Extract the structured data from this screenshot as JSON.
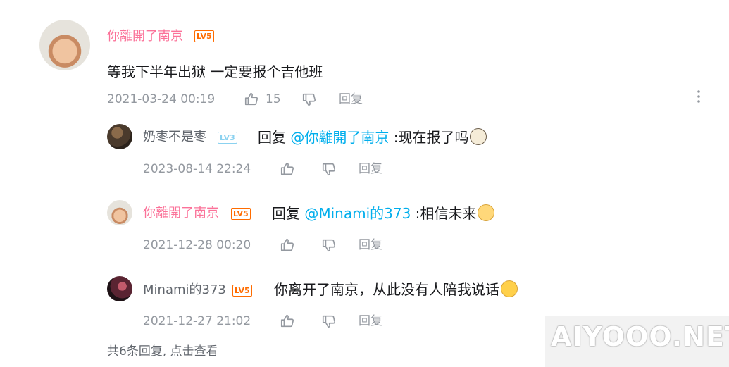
{
  "main_comment": {
    "username": "你離開了南京",
    "level": "LV5",
    "text": "等我下半年出狱 一定要报个吉他班",
    "time": "2021-03-24 00:19",
    "likes": "15",
    "reply_label": "回复"
  },
  "replies": [
    {
      "username": "奶枣不是枣",
      "level": "LV3",
      "prefix": "回复 ",
      "mention": "@你離開了南京",
      "text": " :现在报了吗",
      "emoji": "dog-emoji",
      "time": "2023-08-14 22:24",
      "reply_label": "回复"
    },
    {
      "username": "你離開了南京",
      "level": "LV5",
      "prefix": "回复 ",
      "mention": "@Minami的373",
      "text": " :相信未来",
      "emoji": "blush-emoji",
      "time": "2021-12-28 00:20",
      "reply_label": "回复"
    },
    {
      "username": "Minami的373",
      "level": "LV5",
      "text": "你离开了南京，从此没有人陪我说话",
      "emoji": "laugh-emoji",
      "time": "2021-12-27 21:02",
      "reply_label": "回复"
    }
  ],
  "more_replies": "共6条回复, 点击查看",
  "watermark": "AIYOOO.NET",
  "colors": {
    "username_pink": "#fb7299",
    "mention_blue": "#00aeec",
    "meta_gray": "#9499a0",
    "level_orange": "#ff6c00",
    "level_blue": "#8bd2f0"
  }
}
